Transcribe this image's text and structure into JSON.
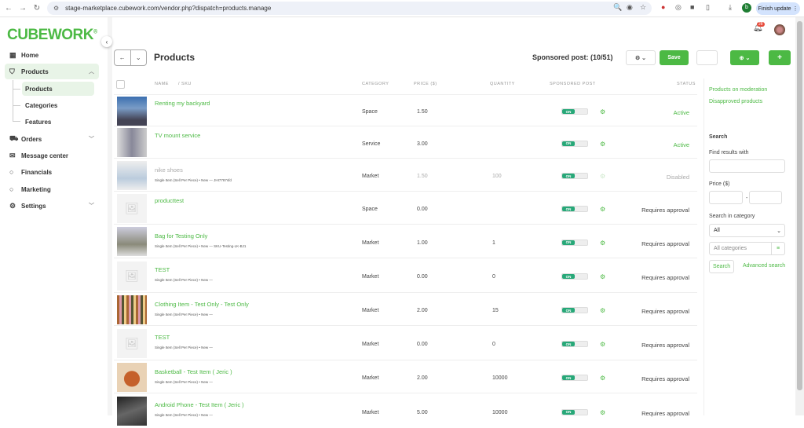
{
  "browser": {
    "url": "stage-marketplace.cubework.com/vendor.php?dispatch=products.manage",
    "finish_update": "Finish update",
    "profile_initial": "b"
  },
  "sidebar": {
    "logo": "CUBEWORK",
    "logo_mark": "®",
    "items": [
      {
        "label": "Home",
        "icon": "grid-icon"
      },
      {
        "label": "Products",
        "icon": "bag-icon"
      },
      {
        "label": "Orders",
        "icon": "cart-icon"
      },
      {
        "label": "Message center",
        "icon": "mail-icon"
      },
      {
        "label": "Financials",
        "icon": "circle-icon"
      },
      {
        "label": "Marketing",
        "icon": "circle-icon"
      },
      {
        "label": "Settings",
        "icon": "gear-icon"
      }
    ],
    "sub_items": [
      "Products",
      "Categories",
      "Features"
    ]
  },
  "header": {
    "notification_count": "28",
    "title": "Products",
    "sponsored": "Sponsored post: (10/51)",
    "save": "Save",
    "add": "+"
  },
  "table": {
    "columns": {
      "name": "NAME",
      "sku": "/  SKU",
      "category": "CATEGORY",
      "price": "PRICE ($)",
      "quantity": "QUANTITY",
      "sponsored": "SPONSORED POST",
      "status": "STATUS"
    },
    "toggle_on": "ON",
    "rows": [
      {
        "name": "Renting my backyard",
        "sub": "",
        "category": "Space",
        "price": "1.50",
        "quantity": "",
        "status": "Active",
        "thumb": "photo",
        "disabled": false
      },
      {
        "name": "TV mount service",
        "sub": "",
        "category": "Service",
        "price": "3.00",
        "quantity": "",
        "status": "Active",
        "thumb": "photo",
        "disabled": false
      },
      {
        "name": "nike shoes",
        "sub": "Single Item (Sell Per Piece) • New — JHI7787sfd",
        "category": "Market",
        "price": "1.50",
        "quantity": "100",
        "status": "Disabled",
        "thumb": "photo",
        "disabled": true
      },
      {
        "name": "producttest",
        "sub": "",
        "category": "Space",
        "price": "0.00",
        "quantity": "",
        "status": "Requires approval",
        "thumb": "placeholder",
        "disabled": false
      },
      {
        "name": "Bag for Testing Only",
        "sub": "Single Item (Sell Per Piece) • New — SKU-Testing-LK-BJ1",
        "category": "Market",
        "price": "1.00",
        "quantity": "1",
        "status": "Requires approval",
        "thumb": "photo",
        "disabled": false
      },
      {
        "name": "TEST",
        "sub": "Single Item (Sell Per Piece) • New —",
        "category": "Market",
        "price": "0.00",
        "quantity": "0",
        "status": "Requires approval",
        "thumb": "placeholder",
        "disabled": false
      },
      {
        "name": "Clothing Item - Test Only - Test Only",
        "sub": "Single Item (Sell Per Piece) • New —",
        "category": "Market",
        "price": "2.00",
        "quantity": "15",
        "status": "Requires approval",
        "thumb": "photo",
        "disabled": false
      },
      {
        "name": "TEST",
        "sub": "Single Item (Sell Per Piece) • New —",
        "category": "Market",
        "price": "0.00",
        "quantity": "0",
        "status": "Requires approval",
        "thumb": "placeholder",
        "disabled": false
      },
      {
        "name": "Basketball - Test Item ( Jeric )",
        "sub": "Single Item (Sell Per Piece) • New —",
        "category": "Market",
        "price": "2.00",
        "quantity": "10000",
        "status": "Requires approval",
        "thumb": "photo",
        "disabled": false
      },
      {
        "name": "Android Phone - Test Item ( Jeric )",
        "sub": "Single Item (Sell Per Piece) • New —",
        "category": "Market",
        "price": "5.00",
        "quantity": "10000",
        "status": "Requires approval",
        "thumb": "photo",
        "disabled": false
      }
    ]
  },
  "right": {
    "moderation": "Products on moderation",
    "disapproved": "Disapproved products",
    "search_title": "Search",
    "find_label": "Find results with",
    "price_label": "Price ($)",
    "price_sep": "-",
    "category_label": "Search in category",
    "category_value": "All",
    "all_categories": "All categories",
    "search_btn": "Search",
    "advanced": "Advanced search"
  },
  "colors": {
    "accent": "#4cb944",
    "toggle": "#27a878"
  }
}
